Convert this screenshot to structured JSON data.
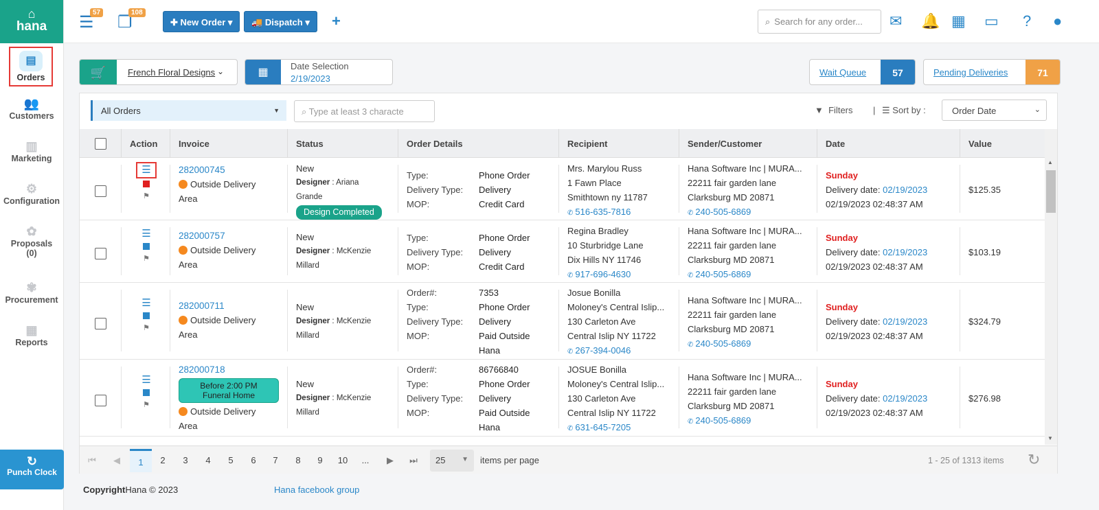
{
  "brand": {
    "name": "hana"
  },
  "sidebar": {
    "items": [
      {
        "label": "Orders"
      },
      {
        "label": "Customers"
      },
      {
        "label": "Marketing"
      },
      {
        "label": "Configuration"
      },
      {
        "label": "Proposals"
      },
      {
        "label": "Procurement"
      },
      {
        "label": "Reports"
      }
    ],
    "proposals_count": "(0)",
    "punch_clock": "Punch Clock"
  },
  "topbar": {
    "badge1": "57",
    "badge2": "108",
    "new_order": "New Order",
    "dispatch": "Dispatch",
    "search_placeholder": "Search for any order..."
  },
  "filters": {
    "store": "French Floral Designs",
    "date_label": "Date Selection",
    "date_value": "2/19/2023",
    "wait_queue_label": "Wait Queue",
    "wait_queue_count": "57",
    "pending_label": "Pending Deliveries",
    "pending_count": "71",
    "order_filter": "All Orders",
    "mini_search_placeholder": "Type at least 3 characte",
    "filters_label": "Filters",
    "sort_label": "Sort by :",
    "sort_value": "Order Date"
  },
  "table": {
    "headers": [
      "Action",
      "Invoice",
      "Status",
      "Order Details",
      "Recipient",
      "Sender/Customer",
      "Date",
      "Value"
    ],
    "rows": [
      {
        "invoice": "282000745",
        "area_line1": "Outside Delivery",
        "area_line2": "Area",
        "status": "New",
        "designer_label": "Designer",
        "designer_first": "Ariana",
        "designer_last": "Grande",
        "badge": "Design Completed",
        "d1k": "Type:",
        "d1v": "Phone Order",
        "d2k": "Delivery Type:",
        "d2v": "Delivery",
        "d3k": "MOP:",
        "d3v": "Credit Card",
        "r1": "Mrs. Marylou Russ",
        "r2": "1 Fawn Place",
        "r3": "Smithtown ny 11787",
        "rphone": "516-635-7816",
        "s1": "Hana Software Inc | MURA...",
        "s2": "22211 fair garden lane",
        "s3": "Clarksburg MD 20871",
        "sphone": "240-505-6869",
        "day": "Sunday",
        "dd_label": "Delivery date:",
        "dd_val": "02/19/2023",
        "ts": "02/19/2023 02:48:37 AM",
        "value": "$125.35"
      },
      {
        "invoice": "282000757",
        "area_line1": "Outside Delivery",
        "area_line2": "Area",
        "status": "New",
        "designer_label": "Designer",
        "designer_first": "McKenzie",
        "designer_last": "Millard",
        "d1k": "Type:",
        "d1v": "Phone Order",
        "d2k": "Delivery Type:",
        "d2v": "Delivery",
        "d3k": "MOP:",
        "d3v": "Credit Card",
        "r1": "Regina Bradley",
        "r2": "10 Sturbridge Lane",
        "r3": "Dix Hills NY 11746",
        "rphone": "917-696-4630",
        "s1": "Hana Software Inc | MURA...",
        "s2": "22211 fair garden lane",
        "s3": "Clarksburg MD 20871",
        "sphone": "240-505-6869",
        "day": "Sunday",
        "dd_label": "Delivery date:",
        "dd_val": "02/19/2023",
        "ts": "02/19/2023 02:48:37 AM",
        "value": "$103.19"
      },
      {
        "invoice": "282000711",
        "area_line1": "Outside Delivery",
        "area_line2": "Area",
        "status": "New",
        "designer_label": "Designer",
        "designer_first": "McKenzie",
        "designer_last": "Millard",
        "d0k": "Order#:",
        "d0v": "7353",
        "d1k": "Type:",
        "d1v": "Phone Order",
        "d2k": "Delivery Type:",
        "d2v": "Delivery",
        "d3k": "MOP:",
        "d3v": "Paid Outside",
        "d3v2": "Hana",
        "r1": "Josue Bonilla",
        "r2": "Moloney's Central Islip...",
        "r3": "130 Carleton Ave",
        "r4": "Central Islip NY 11722",
        "rphone": "267-394-0046",
        "s1": "Hana Software Inc | MURA...",
        "s2": "22211 fair garden lane",
        "s3": "Clarksburg MD 20871",
        "sphone": "240-505-6869",
        "day": "Sunday",
        "dd_label": "Delivery date:",
        "dd_val": "02/19/2023",
        "ts": "02/19/2023 02:48:37 AM",
        "value": "$324.79"
      },
      {
        "invoice": "282000718",
        "tag_line1": "Before 2:00 PM",
        "tag_line2": "Funeral Home",
        "area_line1": "Outside Delivery",
        "area_line2": "Area",
        "status": "New",
        "designer_label": "Designer",
        "designer_first": "McKenzie",
        "designer_last": "Millard",
        "d0k": "Order#:",
        "d0v": "86766840",
        "d1k": "Type:",
        "d1v": "Phone Order",
        "d2k": "Delivery Type:",
        "d2v": "Delivery",
        "d3k": "MOP:",
        "d3v": "Paid Outside",
        "d3v2": "Hana",
        "r1": "JOSUE Bonilla",
        "r2": "Moloney's Central Islip...",
        "r3": "130 Carleton Ave",
        "r4": "Central Islip NY 11722",
        "rphone": "631-645-7205",
        "s1": "Hana Software Inc | MURA...",
        "s2": "22211 fair garden lane",
        "s3": "Clarksburg MD 20871",
        "sphone": "240-505-6869",
        "day": "Sunday",
        "dd_label": "Delivery date:",
        "dd_val": "02/19/2023",
        "ts": "02/19/2023 02:48:37 AM",
        "value": "$276.98"
      }
    ]
  },
  "pager": {
    "pages": [
      "1",
      "2",
      "3",
      "4",
      "5",
      "6",
      "7",
      "8",
      "9",
      "10",
      "..."
    ],
    "per_page": "25",
    "per_page_label": "items per page",
    "count": "1 - 25 of 1313 items"
  },
  "footer": {
    "copyright_label": "Copyright",
    "copyright_text": "Hana © 2023",
    "fb_link": "Hana facebook group"
  }
}
